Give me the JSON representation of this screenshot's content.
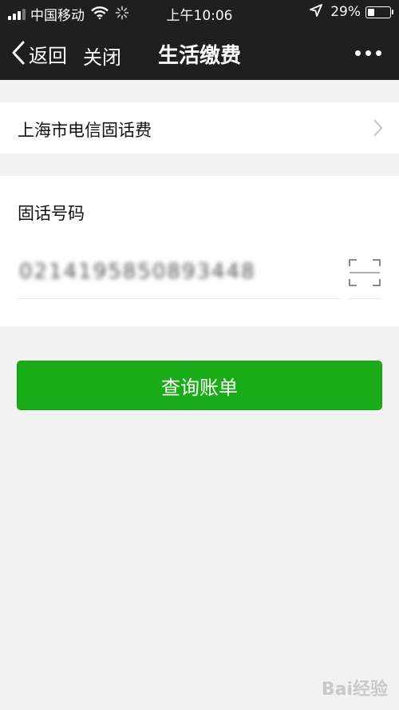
{
  "status_bar": {
    "carrier": "中国移动",
    "time": "上午10:06",
    "battery": "29%",
    "battery_level": 0.29,
    "icons": [
      "signal-icon",
      "wifi-icon",
      "loading-icon",
      "location-arrow-icon",
      "battery-icon"
    ]
  },
  "nav": {
    "back_label": "返回",
    "close_label": "关闭",
    "title": "生活缴费",
    "more_icon": "more-dots-icon"
  },
  "provider": {
    "label": "上海市电信固话费",
    "icon": "chevron-right-icon"
  },
  "phone": {
    "label": "固话号码",
    "value": "0214195850893448",
    "scan_icon": "scan-icon"
  },
  "query_button": {
    "label": "查询账单",
    "color": "#1aad19"
  },
  "watermark": "Bai经验",
  "colors": {
    "nav_bg": "#1f1f1f",
    "page_bg": "#f2f2f2",
    "card_bg": "#ffffff",
    "accent": "#1aad19"
  }
}
